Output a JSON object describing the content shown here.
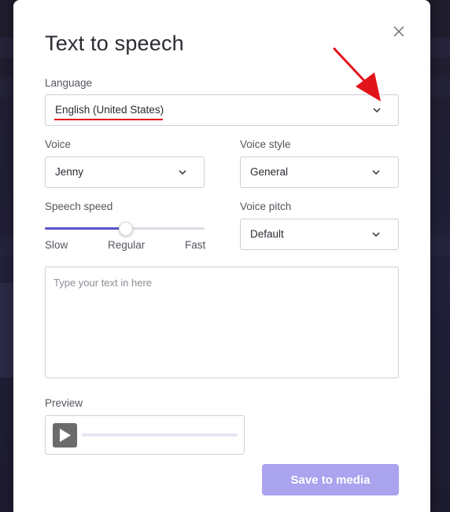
{
  "dialog": {
    "title": "Text to speech",
    "close_icon": "close-icon"
  },
  "language": {
    "label": "Language",
    "value": "English (United States)"
  },
  "voice": {
    "label": "Voice",
    "value": "Jenny"
  },
  "voice_style": {
    "label": "Voice style",
    "value": "General"
  },
  "speech_speed": {
    "label": "Speech speed",
    "slow_label": "Slow",
    "regular_label": "Regular",
    "fast_label": "Fast",
    "level": 0.5
  },
  "voice_pitch": {
    "label": "Voice pitch",
    "value": "Default"
  },
  "text_input": {
    "placeholder": "Type your text in here",
    "value": ""
  },
  "preview": {
    "label": "Preview",
    "progress": 0
  },
  "save_button": {
    "label": "Save to media"
  },
  "colors": {
    "accent": "#5a54c8",
    "save_button_disabled": "#aaa3ee",
    "annotation": "#e2141b"
  }
}
